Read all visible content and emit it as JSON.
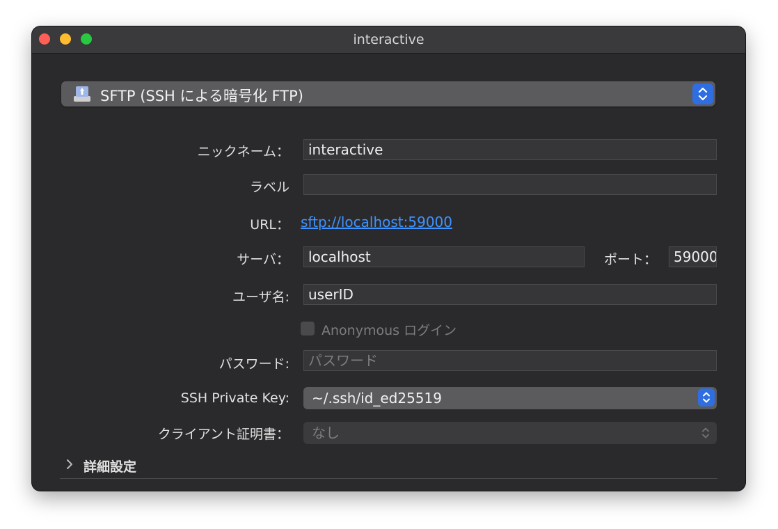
{
  "window": {
    "title": "interactive"
  },
  "protocol": {
    "label": "SFTP (SSH による暗号化 FTP)",
    "icon": "server-drive-icon"
  },
  "form": {
    "nickname": {
      "label": "ニックネーム：",
      "value": "interactive"
    },
    "label_field": {
      "label": "ラベル",
      "value": ""
    },
    "url": {
      "label": "URL：",
      "value": "sftp://localhost:59000"
    },
    "server": {
      "label": "サーバ：",
      "value": "localhost"
    },
    "port": {
      "label": "ポート：",
      "value": "59000"
    },
    "username": {
      "label": "ユーザ名:",
      "value": "userID"
    },
    "anonymous": {
      "label": "Anonymous ログイン",
      "checked": false
    },
    "password": {
      "label": "パスワード:",
      "placeholder": "パスワード"
    },
    "ssh_key": {
      "label": "SSH Private Key:",
      "value": "~/.ssh/id_ed25519"
    },
    "client_cert": {
      "label": "クライアント証明書：",
      "value": "なし"
    }
  },
  "advanced": {
    "label": "詳細設定"
  },
  "colors": {
    "accent": "#2f6ee0",
    "link": "#3f93ff",
    "window_bg": "#2a2a2c"
  }
}
